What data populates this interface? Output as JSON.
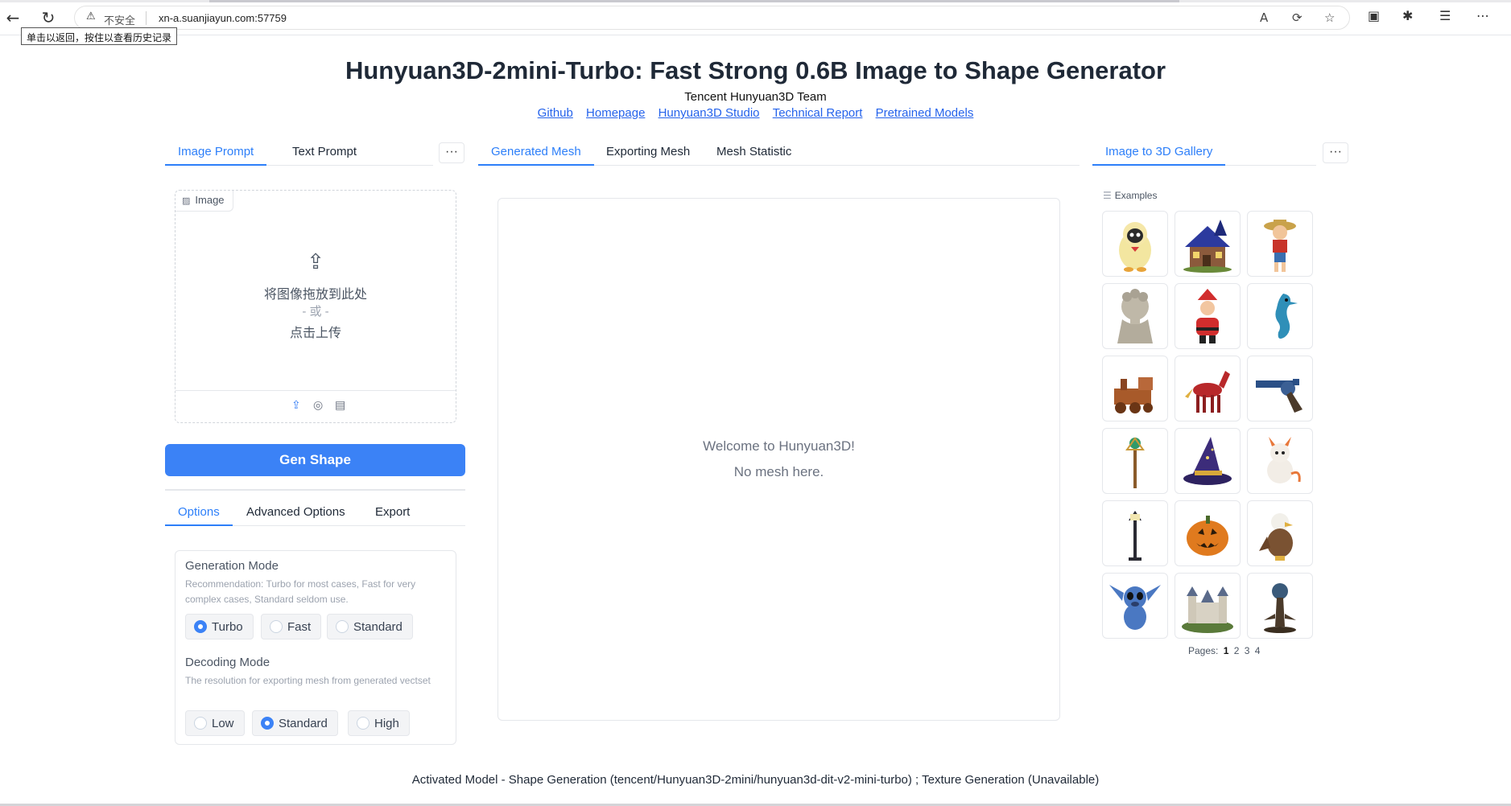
{
  "browser": {
    "back_icon": "back-arrow-icon",
    "reload_icon": "reload-icon",
    "insecure_label": "不安全",
    "url": "xn-a.suanjiayun.com:57759",
    "tooltip": "单击以返回，按住以查看历史记录"
  },
  "header": {
    "title": "Hunyuan3D-2mini-Turbo: Fast Strong 0.6B Image to Shape Generator",
    "team": "Tencent Hunyuan3D Team",
    "links": [
      "Github",
      "Homepage",
      "Hunyuan3D Studio",
      "Technical Report",
      "Pretrained Models"
    ]
  },
  "left": {
    "tabs": [
      "Image Prompt",
      "Text Prompt"
    ],
    "more": "···",
    "image_label": "Image",
    "upload_drop": "将图像拖放到此处",
    "upload_or": "- 或 -",
    "upload_click": "点击上传",
    "gen_button": "Gen Shape",
    "option_tabs": [
      "Options",
      "Advanced Options",
      "Export"
    ],
    "generation_mode": {
      "title": "Generation Mode",
      "desc": "Recommendation: Turbo for most cases, Fast for very complex cases, Standard seldom use.",
      "options": [
        "Turbo",
        "Fast",
        "Standard"
      ],
      "selected": "Turbo"
    },
    "decoding_mode": {
      "title": "Decoding Mode",
      "desc": "The resolution for exporting mesh from generated vectset",
      "options": [
        "Low",
        "Standard",
        "High"
      ],
      "selected": "Standard"
    }
  },
  "center": {
    "tabs": [
      "Generated Mesh",
      "Exporting Mesh",
      "Mesh Statistic"
    ],
    "welcome": "Welcome to Hunyuan3D!",
    "no_mesh": "No mesh here."
  },
  "right": {
    "tab": "Image to 3D Gallery",
    "more": "···",
    "examples_label": "Examples",
    "examples": [
      "penguin-toy",
      "blue-house",
      "pirate-boy",
      "stone-bust",
      "santa-claus",
      "seahorse",
      "toy-train",
      "red-horse",
      "revolver",
      "magic-staff",
      "wizard-hat",
      "baby-dragon",
      "street-lamp",
      "pumpkin",
      "eagle",
      "stitch",
      "castle",
      "tree-orb"
    ],
    "pages_label": "Pages:",
    "pages": [
      "1",
      "2",
      "3",
      "4"
    ],
    "current_page": "1"
  },
  "footer": "Activated Model - Shape Generation (tencent/Hunyuan3D-2mini/hunyuan3d-dit-v2-mini-turbo) ; Texture Generation (Unavailable)",
  "colors": {
    "accent": "#3b82f6",
    "link": "#2563eb"
  }
}
